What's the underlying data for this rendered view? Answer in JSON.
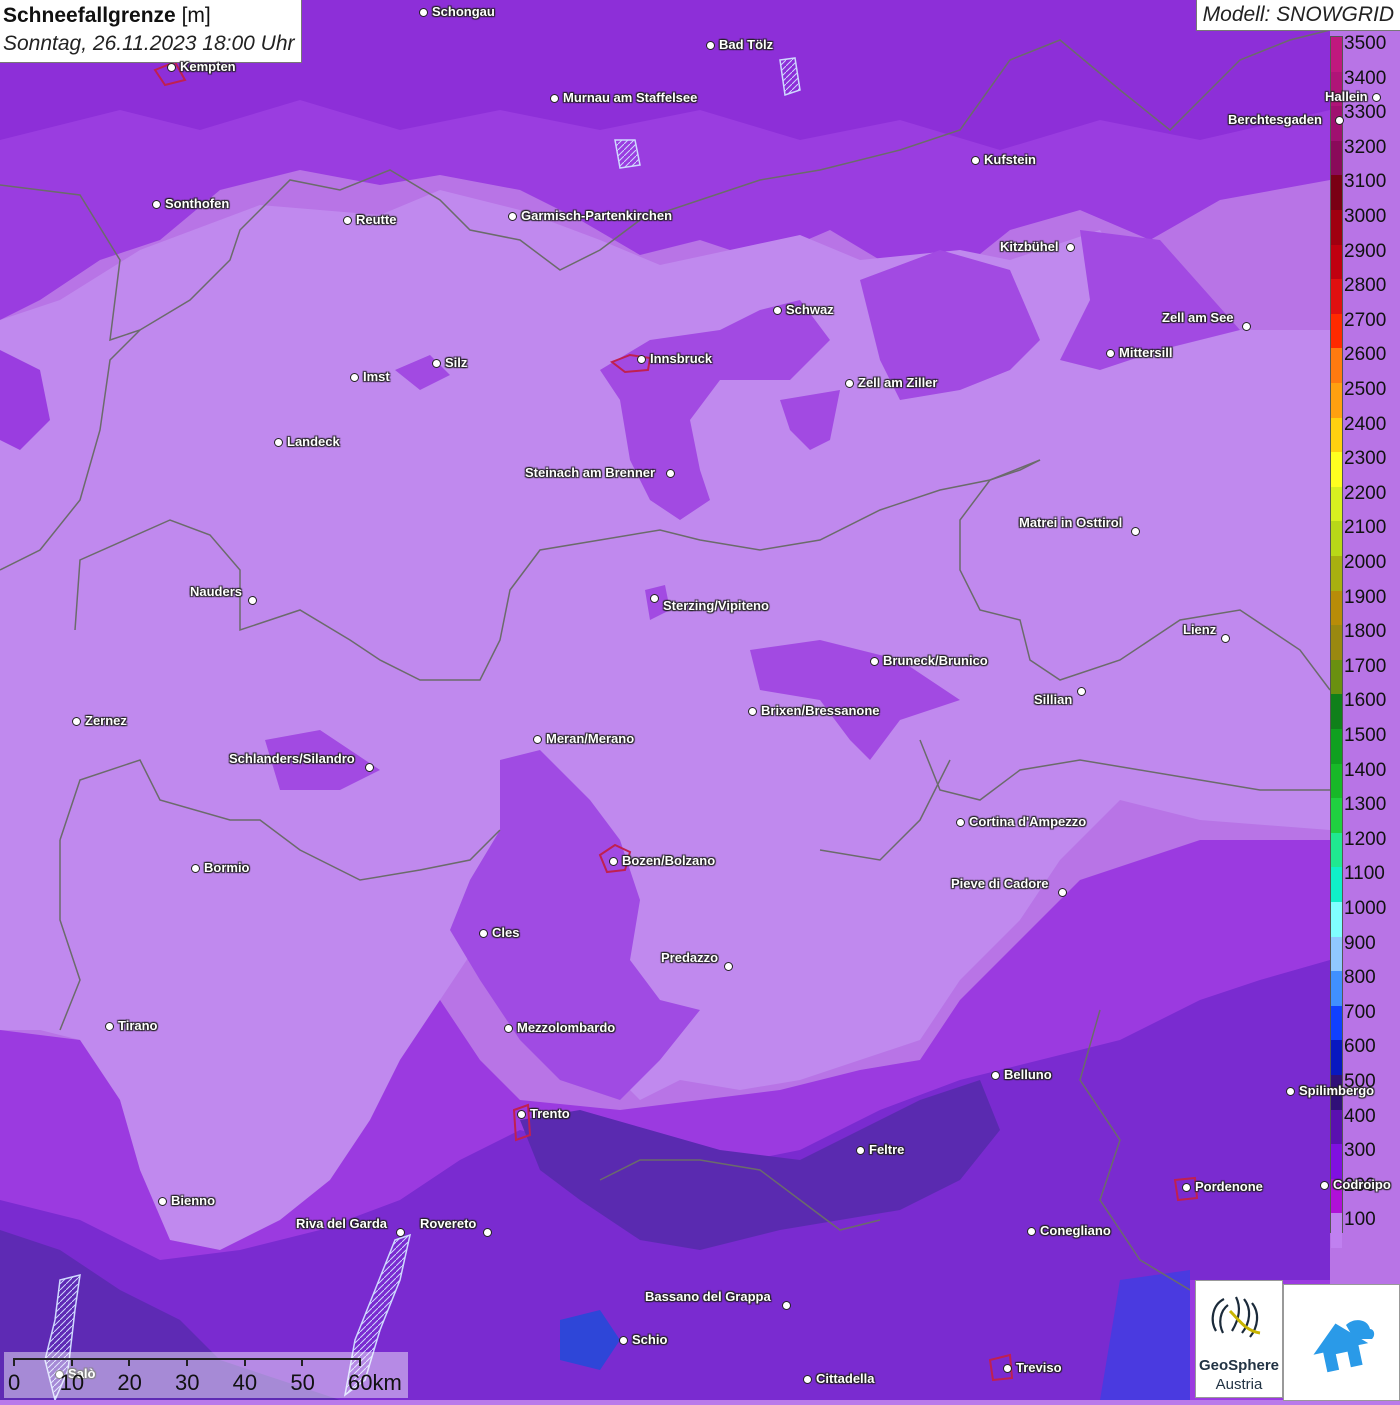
{
  "title": {
    "main": "Schneefallgrenze",
    "unit": "[m]",
    "date": "Sonntag, 26.11.2023 18:00 Uhr"
  },
  "model": "Modell: SNOWGRID",
  "legend": {
    "labels": [
      "3500",
      "3400",
      "3300",
      "3200",
      "3100",
      "3000",
      "2900",
      "2800",
      "2700",
      "2600",
      "2500",
      "2400",
      "2300",
      "2200",
      "2100",
      "2000",
      "1900",
      "1800",
      "1700",
      "1600",
      "1500",
      "1400",
      "1300",
      "1200",
      "1100",
      "1000",
      "900",
      "800",
      "700",
      "600",
      "500",
      "400",
      "300",
      "200",
      "100"
    ],
    "colors": [
      "#c0187e",
      "#b01478",
      "#a01070",
      "#8a0a5a",
      "#7a0014",
      "#a00010",
      "#c00010",
      "#e01010",
      "#ff2a00",
      "#ff7a10",
      "#ffa010",
      "#ffd010",
      "#ffff20",
      "#d8f020",
      "#b8d818",
      "#a8b010",
      "#b88c08",
      "#9a8810",
      "#6a9010",
      "#10801a",
      "#10a020",
      "#18b828",
      "#20d040",
      "#20e890",
      "#10f0c8",
      "#80ffff",
      "#90c8ff",
      "#4090ff",
      "#1040ff",
      "#0818c0",
      "#301078",
      "#5a10b0",
      "#8010e0",
      "#b010d8",
      "#c080f0"
    ]
  },
  "cities": [
    {
      "name": "Schongau"
    },
    {
      "name": "Bad Tölz"
    },
    {
      "name": "Kempten"
    },
    {
      "name": "Murnau am Staffelsee"
    },
    {
      "name": "Hallein"
    },
    {
      "name": "Berchtesgaden"
    },
    {
      "name": "Kufstein"
    },
    {
      "name": "Sonthofen"
    },
    {
      "name": "Reutte"
    },
    {
      "name": "Garmisch-Partenkirchen"
    },
    {
      "name": "Kitzbühel"
    },
    {
      "name": "Schwaz"
    },
    {
      "name": "Zell am See"
    },
    {
      "name": "Mittersill"
    },
    {
      "name": "Innsbruck"
    },
    {
      "name": "Imst"
    },
    {
      "name": "Silz"
    },
    {
      "name": "Zell am Ziller"
    },
    {
      "name": "Landeck"
    },
    {
      "name": "Steinach am Brenner"
    },
    {
      "name": "Matrei in Osttirol"
    },
    {
      "name": "Nauders"
    },
    {
      "name": "Sterzing/Vipiteno"
    },
    {
      "name": "Lienz"
    },
    {
      "name": "Bruneck/Brunico"
    },
    {
      "name": "Sillian"
    },
    {
      "name": "Zernez"
    },
    {
      "name": "Brixen/Bressanone"
    },
    {
      "name": "Meran/Merano"
    },
    {
      "name": "Schlanders/Silandro"
    },
    {
      "name": "Cortina d'Ampezzo"
    },
    {
      "name": "Bozen/Bolzano"
    },
    {
      "name": "Bormio"
    },
    {
      "name": "Pieve di Cadore"
    },
    {
      "name": "Cles"
    },
    {
      "name": "Predazzo"
    },
    {
      "name": "Tirano"
    },
    {
      "name": "Mezzolombardo"
    },
    {
      "name": "Belluno"
    },
    {
      "name": "Spilimbergo"
    },
    {
      "name": "Trento"
    },
    {
      "name": "Feltre"
    },
    {
      "name": "Pordenone"
    },
    {
      "name": "Codroipo"
    },
    {
      "name": "Bienno"
    },
    {
      "name": "Riva del Garda"
    },
    {
      "name": "Rovereto"
    },
    {
      "name": "Conegliano"
    },
    {
      "name": "Bassano del Grappa"
    },
    {
      "name": "Schio"
    },
    {
      "name": "Treviso"
    },
    {
      "name": "Cittadella"
    },
    {
      "name": "Salò"
    }
  ],
  "scalebar": {
    "labels": [
      "0",
      "10",
      "20",
      "30",
      "40",
      "50",
      "60km"
    ]
  },
  "logo": {
    "line1": "GeoSphere",
    "line2": "Austria"
  }
}
